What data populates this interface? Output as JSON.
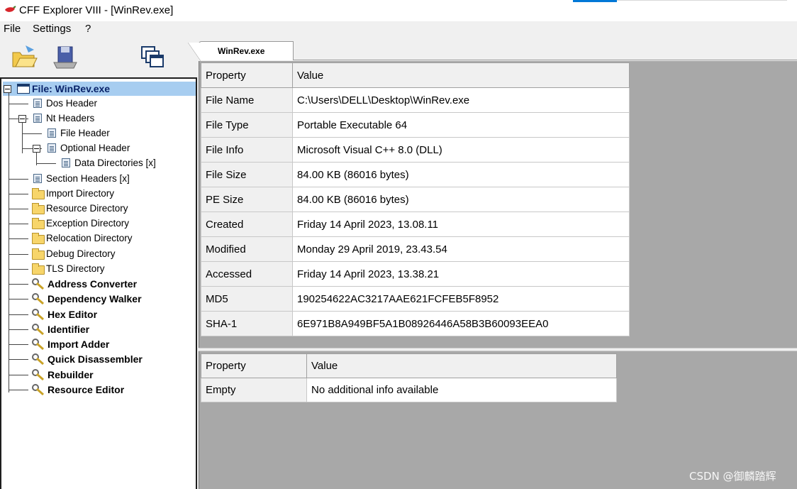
{
  "window": {
    "title": "CFF Explorer VIII - [WinRev.exe]",
    "icon": "pepper-icon"
  },
  "menu": {
    "items": [
      "File",
      "Settings",
      "?"
    ]
  },
  "toolbar": {
    "icons": [
      "open-folder-icon",
      "save-disk-icon",
      "windows-icon"
    ]
  },
  "tree": {
    "root": "File: WinRev.exe",
    "items": [
      {
        "label": "Dos Header",
        "icon": "doc-icon"
      },
      {
        "label": "Nt Headers",
        "icon": "doc-icon"
      },
      {
        "label": "File Header",
        "icon": "doc-icon"
      },
      {
        "label": "Optional Header",
        "icon": "doc-icon"
      },
      {
        "label": "Data Directories [x]",
        "icon": "doc-icon"
      },
      {
        "label": "Section Headers [x]",
        "icon": "doc-icon"
      },
      {
        "label": "Import Directory",
        "icon": "folder-icon"
      },
      {
        "label": "Resource Directory",
        "icon": "folder-icon"
      },
      {
        "label": "Exception Directory",
        "icon": "folder-icon"
      },
      {
        "label": "Relocation Directory",
        "icon": "folder-icon"
      },
      {
        "label": "Debug Directory",
        "icon": "folder-icon"
      },
      {
        "label": "TLS Directory",
        "icon": "folder-icon"
      },
      {
        "label": "Address Converter",
        "icon": "tool-icon"
      },
      {
        "label": "Dependency Walker",
        "icon": "tool-icon"
      },
      {
        "label": "Hex Editor",
        "icon": "tool-icon"
      },
      {
        "label": "Identifier",
        "icon": "tool-icon"
      },
      {
        "label": "Import Adder",
        "icon": "tool-icon"
      },
      {
        "label": "Quick Disassembler",
        "icon": "tool-icon"
      },
      {
        "label": "Rebuilder",
        "icon": "tool-icon"
      },
      {
        "label": "Resource Editor",
        "icon": "tool-icon"
      }
    ]
  },
  "tab": {
    "label": "WinRev.exe"
  },
  "properties": {
    "headers": [
      "Property",
      "Value"
    ],
    "rows": [
      [
        "File Name",
        "C:\\Users\\DELL\\Desktop\\WinRev.exe"
      ],
      [
        "File Type",
        "Portable Executable 64"
      ],
      [
        "File Info",
        "Microsoft Visual C++ 8.0 (DLL)"
      ],
      [
        "File Size",
        "84.00 KB (86016 bytes)"
      ],
      [
        "PE Size",
        "84.00 KB (86016 bytes)"
      ],
      [
        "Created",
        "Friday 14 April 2023, 13.08.11"
      ],
      [
        "Modified",
        "Monday 29 April 2019, 23.43.54"
      ],
      [
        "Accessed",
        "Friday 14 April 2023, 13.38.21"
      ],
      [
        "MD5",
        "190254622AC3217AAE621FCFEB5F8952"
      ],
      [
        "SHA-1",
        "6E971B8A949BF5A1B08926446A58B3B60093EEA0"
      ]
    ]
  },
  "extra": {
    "headers": [
      "Property",
      "Value"
    ],
    "rows": [
      [
        "Empty",
        "No additional info available"
      ]
    ]
  },
  "watermark": "CSDN @御麟踏辉"
}
